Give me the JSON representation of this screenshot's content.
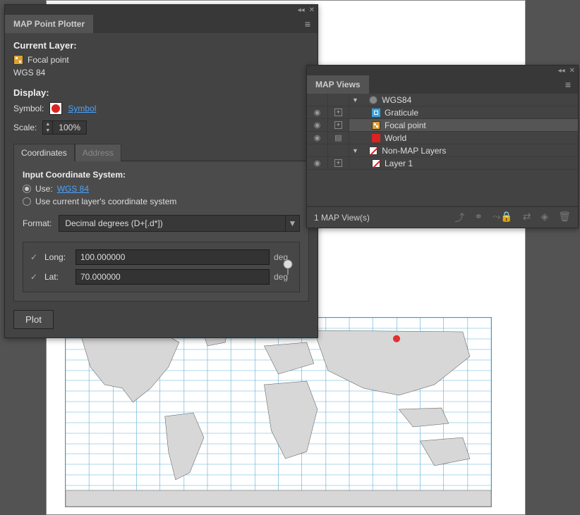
{
  "plotter": {
    "title": "MAP Point Plotter",
    "current_layer_heading": "Current Layer:",
    "layer_name": "Focal point",
    "crs": "WGS 84",
    "display_heading": "Display:",
    "symbol_label": "Symbol:",
    "symbol_link": "Symbol",
    "scale_label": "Scale:",
    "scale_value": "100%",
    "tabs": {
      "coordinates": "Coordinates",
      "address": "Address"
    },
    "input_cs_heading": "Input Coordinate System:",
    "use_label": "Use:",
    "use_link": "WGS 84",
    "use_current_label": "Use current layer's coordinate system",
    "format_label": "Format:",
    "format_value": "Decimal degrees (D+[.d*])",
    "long_label": "Long:",
    "long_value": "100.000000",
    "lat_label": "Lat:",
    "lat_value": "70.000000",
    "deg": "deg",
    "plot_btn": "Plot"
  },
  "views": {
    "title": "MAP Views",
    "root": "WGS84",
    "items": [
      "Graticule",
      "Focal point",
      "World"
    ],
    "nonmap": "Non-MAP Layers",
    "nonmap_items": [
      "Layer 1"
    ],
    "status": "1 MAP View(s)"
  },
  "map": {
    "point": {
      "lon": 100,
      "lat": 70
    }
  },
  "icons": {
    "eye": "◉",
    "collapse": "◂◂",
    "close": "✕",
    "menu": "≡",
    "list": "▤",
    "up": "▲",
    "down": "▼",
    "caret": "▼",
    "check": "✓",
    "tri_down": "▼",
    "upload": "⤴",
    "link": "⚭",
    "lock": "⤳🔒",
    "swap": "⇄",
    "layers": "◈",
    "trash": "🗑"
  }
}
